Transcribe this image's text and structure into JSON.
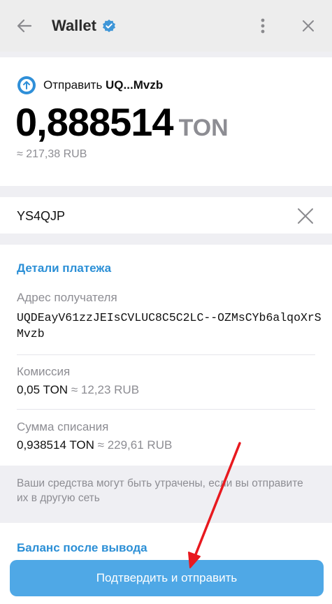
{
  "header": {
    "title": "Wallet",
    "back_icon": "arrow-left-icon",
    "verified_icon": "verified-badge-icon",
    "menu_icon": "vertical-dots-icon",
    "close_icon": "close-icon"
  },
  "transfer": {
    "action": "Отправить",
    "recipient_short": "UQ...Mvzb",
    "amount": "0,888514",
    "currency": "TON",
    "fiat": "≈ 217,38 RUB"
  },
  "comment": {
    "value": "YS4QJP",
    "clear_icon": "close-icon"
  },
  "details": {
    "title": "Детали платежа",
    "recipient_label": "Адрес получателя",
    "recipient_address": "UQDEayV61zzJEIsCVLUC8C5C2LC--OZMsCYb6alqoXrSMvzb",
    "fee_label": "Комиссия",
    "fee_value": "0,05 TON",
    "fee_fiat": "≈ 12,23 RUB",
    "total_label": "Сумма списания",
    "total_value": "0,938514 TON",
    "total_fiat": "≈ 229,61 RUB"
  },
  "warning": "Ваши средства могут быть утрачены, если вы отправите их в другую сеть",
  "balance_after": {
    "title": "Баланс после вывода"
  },
  "confirm_button": "Подтвердить и отправить",
  "colors": {
    "accent": "#2b8fd6",
    "button": "#4fa8e6",
    "annotation_arrow": "#e8191f"
  }
}
